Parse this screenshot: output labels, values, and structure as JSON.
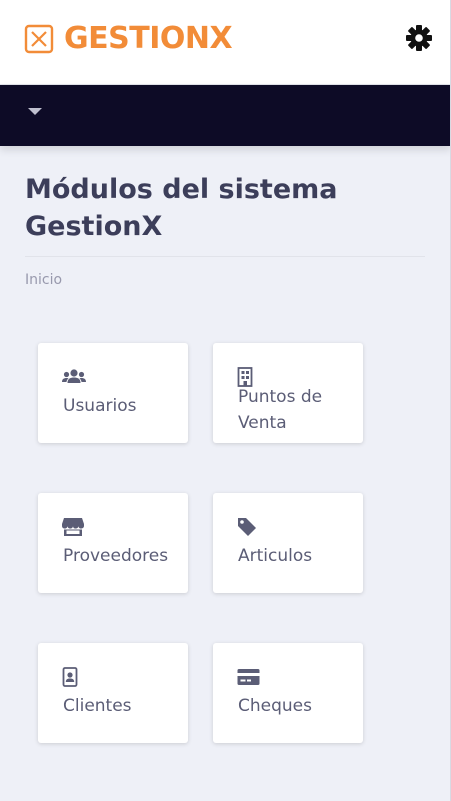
{
  "brand": {
    "name": "GESTIONX",
    "accent_color": "#f28c38",
    "icon": "x-box-logo-icon"
  },
  "header": {
    "settings_icon": "gear-icon"
  },
  "navbar": {
    "background": "#0d0b26",
    "toggle_icon": "caret-down-icon"
  },
  "page": {
    "title": "Módulos del sistema GestionX",
    "title_color": "#3c3e5a",
    "breadcrumb": "Inicio"
  },
  "modules": [
    {
      "label": "Usuarios",
      "icon": "users-icon"
    },
    {
      "label": "Puntos de Venta",
      "icon": "building-icon"
    },
    {
      "label": "Proveedores",
      "icon": "store-icon"
    },
    {
      "label": "Articulos",
      "icon": "tag-icon"
    },
    {
      "label": "Clientes",
      "icon": "id-badge-icon"
    },
    {
      "label": "Cheques",
      "icon": "credit-card-icon"
    }
  ]
}
